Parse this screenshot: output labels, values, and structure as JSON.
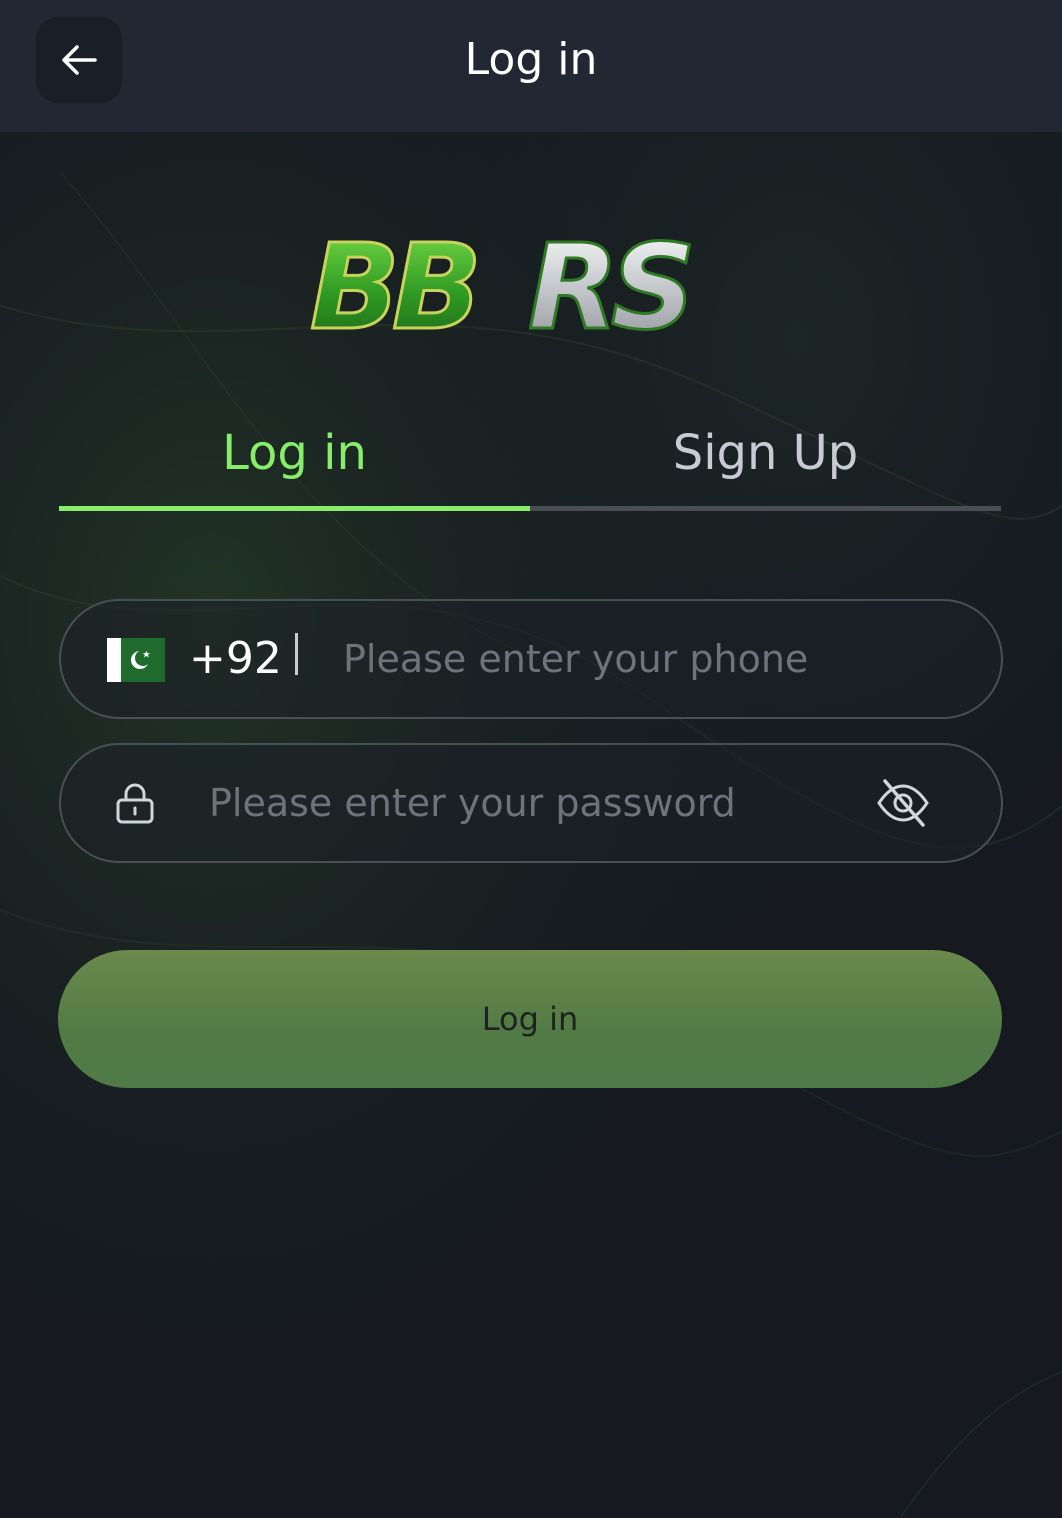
{
  "header": {
    "title": "Log in",
    "back_icon": "arrow-left-icon"
  },
  "logo": {
    "text": "BBRS",
    "colors": {
      "green": "#3fae2a",
      "silver": "#d8dadc",
      "gold_outline": "#c8d35a"
    }
  },
  "tabs": [
    {
      "label": "Log in",
      "active": true
    },
    {
      "label": "Sign Up",
      "active": false
    }
  ],
  "phone": {
    "country_flag": "pakistan-flag-icon",
    "dial_code": "+92",
    "placeholder": "Please enter your phone",
    "value": ""
  },
  "password": {
    "lock_icon": "lock-icon",
    "placeholder": "Please enter your password",
    "value": "",
    "visibility_icon": "eye-off-icon"
  },
  "submit": {
    "label": "Log in"
  },
  "colors": {
    "background": "#161a20",
    "header_bg": "#232733",
    "accent_green": "#86ee6b",
    "button_green": "#5a8048",
    "inactive_tab": "#c8ccd2",
    "placeholder": "#6e737b"
  }
}
